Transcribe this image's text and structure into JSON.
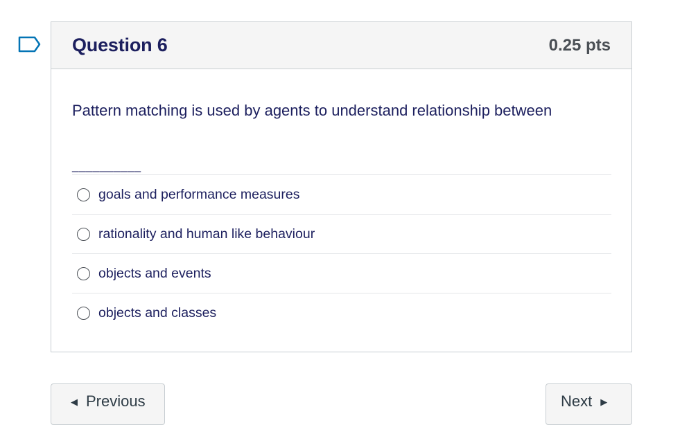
{
  "question": {
    "title": "Question 6",
    "points": "0.25 pts",
    "text": "Pattern matching is used by agents to understand relationship between",
    "blank": "__________",
    "answers": [
      {
        "label": "goals and performance measures"
      },
      {
        "label": "rationality and human like behaviour"
      },
      {
        "label": "objects and events"
      },
      {
        "label": "objects and classes"
      }
    ]
  },
  "nav": {
    "previous_label": "Previous",
    "next_label": "Next"
  },
  "icons": {
    "flag": "bookmark-flag-icon",
    "prev": "caret-left-icon",
    "next": "caret-right-icon"
  },
  "colors": {
    "title": "#1c1f5e",
    "flag_stroke": "#0374b5"
  }
}
